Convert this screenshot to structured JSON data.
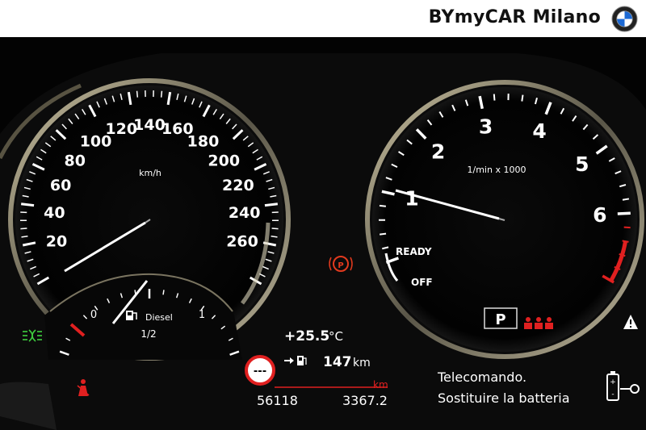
{
  "header": {
    "brand": "BYmyCAR Milano",
    "logo_icon": "bmw-roundel-logo"
  },
  "speedometer": {
    "unit": "km/h",
    "labels": [
      "20",
      "40",
      "60",
      "80",
      "100",
      "120",
      "140",
      "160",
      "180",
      "200",
      "220",
      "240",
      "260"
    ]
  },
  "fuel_gauge": {
    "label_empty": "0",
    "label_half": "1/2",
    "label_full": "1",
    "fuel_type": "Diesel",
    "icon": "fuel-pump-icon"
  },
  "tachometer": {
    "unit": "1/min x 1000",
    "labels": [
      "1",
      "2",
      "3",
      "4",
      "5",
      "6"
    ],
    "ready": "READY",
    "off": "OFF"
  },
  "indicators": {
    "parking_brake_icon": "parking-brake-icon",
    "warning_icon": "warning-triangle-icon",
    "seatbelt_icon": "seatbelt-icon",
    "lights_icon": "parking-lights-icon",
    "gear": "P",
    "passengers_icon": "passengers-icon"
  },
  "info": {
    "temperature": "+25.5",
    "temperature_unit": "°C",
    "speed_limit": "---",
    "range_value": "147",
    "range_unit": "km",
    "distance_unit": "km",
    "odometer": "56118",
    "trip": "3367.2"
  },
  "message": {
    "line1": "Telecomando.",
    "line2": "Sostituire la batteria",
    "icon": "key-battery-icon"
  }
}
